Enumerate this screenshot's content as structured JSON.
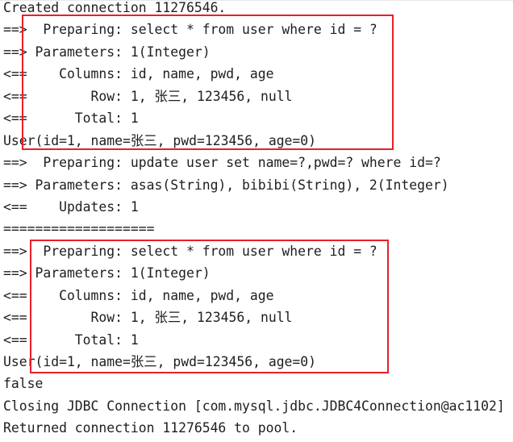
{
  "console": {
    "lines": [
      "Created connection 11276546.",
      "==>  Preparing: select * from user where id = ?",
      "==> Parameters: 1(Integer)",
      "<==    Columns: id, name, pwd, age",
      "<==        Row: 1, 张三, 123456, null",
      "<==      Total: 1",
      "User(id=1, name=张三, pwd=123456, age=0)",
      "==>  Preparing: update user set name=?,pwd=? where id=?",
      "==> Parameters: asas(String), bibibi(String), 2(Integer)",
      "<==    Updates: 1",
      "===================",
      "==>  Preparing: select * from user where id = ?",
      "==> Parameters: 1(Integer)",
      "<==    Columns: id, name, pwd, age",
      "<==        Row: 1, 张三, 123456, null",
      "<==      Total: 1",
      "User(id=1, name=张三, pwd=123456, age=0)",
      "false",
      "Closing JDBC Connection [com.mysql.jdbc.JDBC4Connection@ac1102]",
      "Returned connection 11276546 to pool."
    ]
  },
  "colors": {
    "highlight_box": "#e8202a",
    "text": "#1e1e1e",
    "background": "#ffffff"
  }
}
